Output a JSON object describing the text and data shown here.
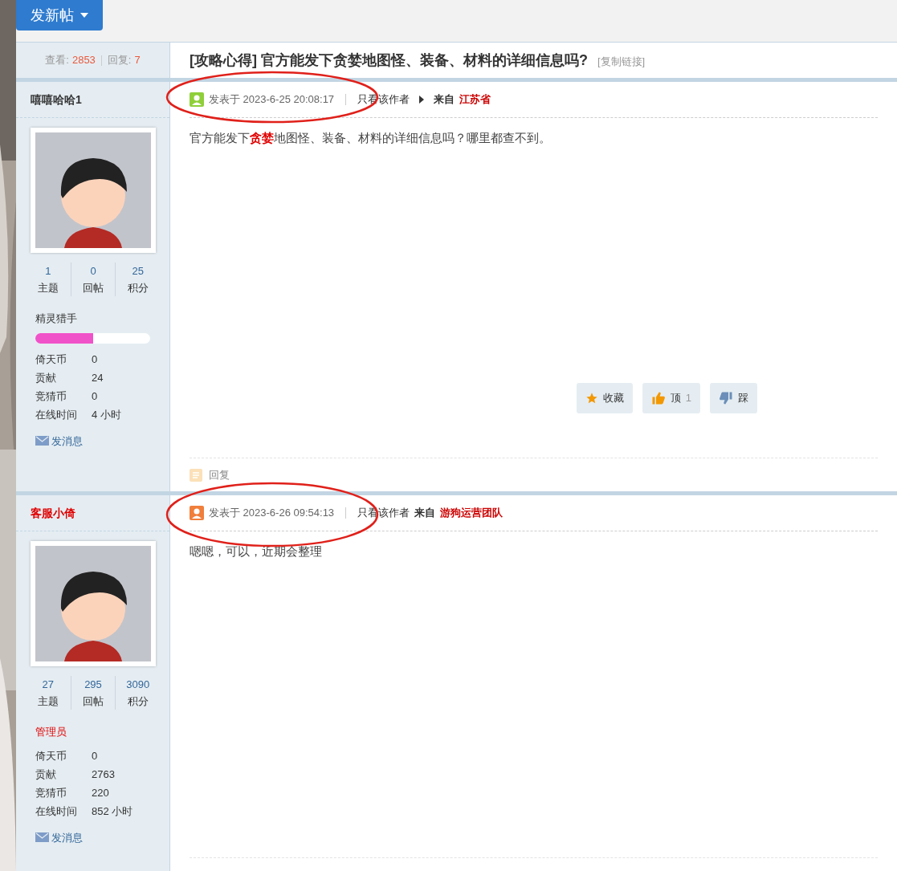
{
  "new_post_button": "发新帖",
  "thread": {
    "views_label": "查看:",
    "views": "2853",
    "replies_label": "回复:",
    "replies": "7",
    "title": "[攻略心得] 官方能发下贪婪地图怪、装备、材料的详细信息吗?",
    "copy_link": "[复制链接]"
  },
  "posts": [
    {
      "author": "嘻嘻哈哈1",
      "kind": "member",
      "stats": [
        {
          "value": "1",
          "label": "主题"
        },
        {
          "value": "0",
          "label": "回帖"
        },
        {
          "value": "25",
          "label": "积分"
        }
      ],
      "rank": {
        "label": "精灵猎手",
        "level": 0.5
      },
      "info": [
        {
          "label": "倚天币",
          "value": "0"
        },
        {
          "label": "贡献",
          "value": "24"
        },
        {
          "label": "竞猜币",
          "value": "0"
        },
        {
          "label": "在线时间",
          "value": "4 小时"
        }
      ],
      "message": "发消息",
      "posted": "发表于 2023-6-25 20:08:17",
      "only_author": "只看该作者",
      "arrow": true,
      "from_label": "来自",
      "from": "江苏省",
      "content": "官方能发下**贪婪**地图怪、装备、材料的详细信息吗？哪里都查不到。",
      "actions": [
        {
          "kind": "favorite",
          "label": "收藏"
        },
        {
          "kind": "up",
          "label": "顶",
          "count": "1"
        },
        {
          "kind": "down",
          "label": "踩"
        }
      ],
      "reply": "回复"
    },
    {
      "author": "客服小倚",
      "kind": "staff",
      "stats": [
        {
          "value": "27",
          "label": "主题"
        },
        {
          "value": "295",
          "label": "回帖"
        },
        {
          "value": "3090",
          "label": "积分"
        }
      ],
      "rank": {
        "label": "管理员"
      },
      "info": [
        {
          "label": "倚天币",
          "value": "0"
        },
        {
          "label": "贡献",
          "value": "2763"
        },
        {
          "label": "竞猜币",
          "value": "220"
        },
        {
          "label": "在线时间",
          "value": "852 小时"
        }
      ],
      "message": "发消息",
      "posted": "发表于 2023-6-26 09:54:13",
      "only_author": "只看该作者",
      "from_label": "来自",
      "from": "游狗运营团队",
      "content": "嗯嗯，可以，近期会整理"
    }
  ]
}
